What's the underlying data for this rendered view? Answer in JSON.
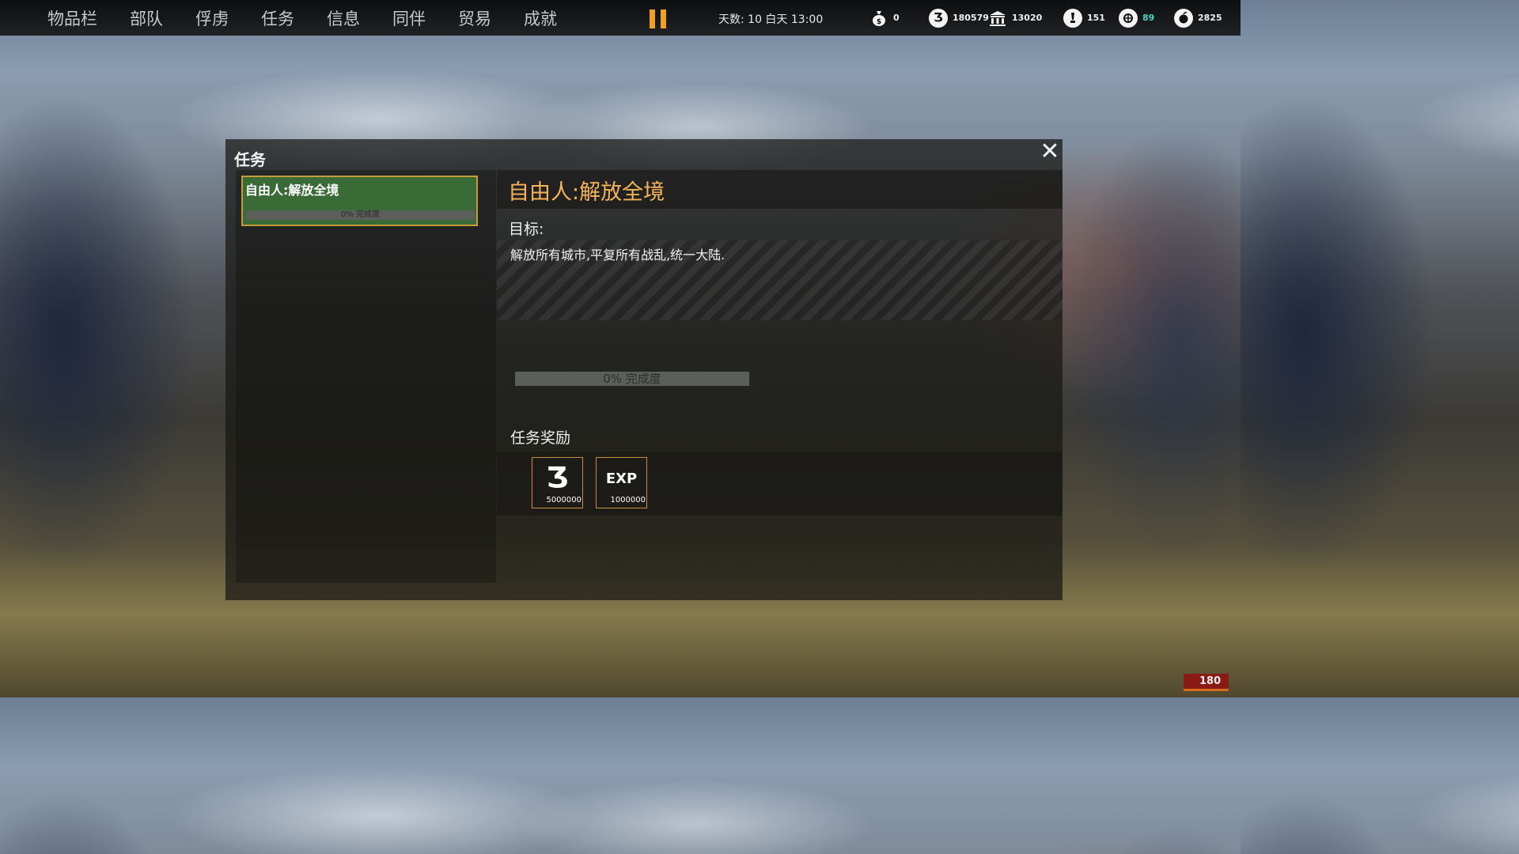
{
  "nav": {
    "items": [
      "物品栏",
      "部队",
      "俘虏",
      "任务",
      "信息",
      "同伴",
      "贸易",
      "成就"
    ]
  },
  "pause": {
    "icon": "pause-icon",
    "color": "#f0a020"
  },
  "clock": {
    "text": "天数: 10 白天 13:00"
  },
  "resources": [
    {
      "icon": "money-bag-icon",
      "value": "0"
    },
    {
      "icon": "coin-icon",
      "glyph": "Ʒ",
      "value": "180579"
    },
    {
      "icon": "bank-icon",
      "value": "13020"
    },
    {
      "icon": "reputation-icon",
      "value": "151"
    },
    {
      "icon": "influence-icon",
      "value": "89",
      "color": "#4fd1c5"
    },
    {
      "icon": "food-icon",
      "value": "2825"
    }
  ],
  "dialog": {
    "title": "任务",
    "close_icon": "close-icon"
  },
  "quest_list": [
    {
      "title": "自由人:解放全境",
      "progress_text": "0% 完成度",
      "progress": 0,
      "selected": true
    }
  ],
  "quest_detail": {
    "title": "自由人:解放全境",
    "goal_label": "目标:",
    "goal_text": "解放所有城市,平复所有战乱,统一大陆.",
    "progress_text": "0% 完成度",
    "progress": 0,
    "reward_label": "任务奖励",
    "rewards": [
      {
        "icon": "coin-icon",
        "glyph": "Ʒ",
        "amount": "5000000"
      },
      {
        "icon": "exp-icon",
        "glyph": "EXP",
        "amount": "1000000"
      }
    ]
  },
  "corner_badge": {
    "value": "180"
  },
  "colors": {
    "accent": "#f5b45a",
    "selected_quest": "#3a6b37",
    "border": "#c89a3c"
  }
}
